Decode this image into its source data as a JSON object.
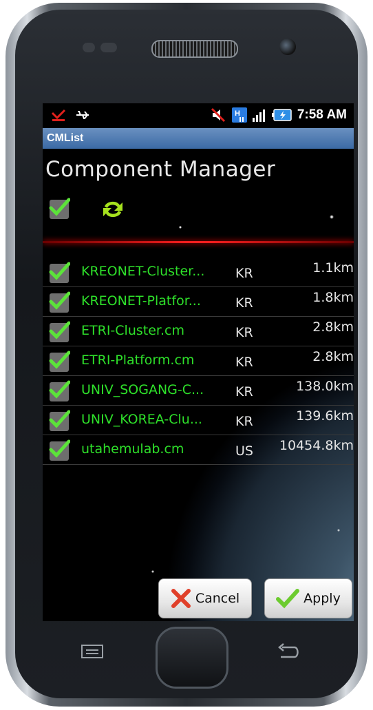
{
  "status_bar": {
    "time": "7:58 AM",
    "icons": [
      "missed-call-icon",
      "usb-icon",
      "mute-icon",
      "hspa-icon",
      "signal-icon",
      "battery-charging-icon"
    ]
  },
  "app": {
    "title": "CMList",
    "heading": "Component Manager"
  },
  "toolbar": {
    "select_all_checked": true,
    "sync_icon": "refresh-icon"
  },
  "components": [
    {
      "name": "KREONET-Cluster...",
      "country": "KR",
      "distance": "1.1km",
      "checked": true
    },
    {
      "name": "KREONET-Platfor...",
      "country": "KR",
      "distance": "1.8km",
      "checked": true
    },
    {
      "name": "ETRI-Cluster.cm",
      "country": "KR",
      "distance": "2.8km",
      "checked": true
    },
    {
      "name": "ETRI-Platform.cm",
      "country": "KR",
      "distance": "2.8km",
      "checked": true
    },
    {
      "name": "UNIV_SOGANG-C...",
      "country": "KR",
      "distance": "138.0km",
      "checked": true
    },
    {
      "name": "UNIV_KOREA-Clu...",
      "country": "KR",
      "distance": "139.6km",
      "checked": true
    },
    {
      "name": "utahemulab.cm",
      "country": "US",
      "distance": "10454.8km",
      "checked": true
    }
  ],
  "buttons": {
    "cancel_label": "Cancel",
    "apply_label": "Apply"
  },
  "colors": {
    "item_text": "#2ee02a",
    "title_bar": "#4a78b2",
    "divider": "#ff2020"
  }
}
